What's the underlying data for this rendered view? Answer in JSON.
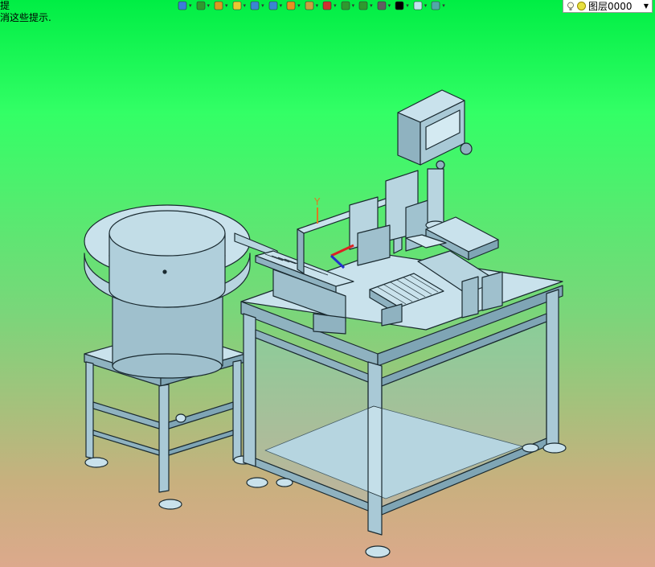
{
  "status": {
    "line1": "提",
    "line2": "消这些提示."
  },
  "toolbar": {
    "tools": [
      {
        "icon": "exit-sketch-icon",
        "color": "#3b7dd8"
      },
      {
        "icon": "smart-dimension-icon",
        "color": "#2e9a2e"
      },
      {
        "icon": "pencil-icon",
        "color": "#d89a20"
      },
      {
        "icon": "feature-yellow-icon",
        "color": "#e8c830"
      },
      {
        "icon": "view-cube-icon",
        "color": "#3a86d4"
      },
      {
        "icon": "section-view-icon",
        "color": "#3a86d4"
      },
      {
        "icon": "display-style-icon",
        "color": "#e89020"
      },
      {
        "icon": "appearance-icon",
        "color": "#c8a040"
      },
      {
        "icon": "triad-icon",
        "color": "#d03030"
      },
      {
        "icon": "view-settings-icon",
        "color": "#2e9a2e"
      },
      {
        "icon": "scene-icon",
        "color": "#2e9a2e"
      },
      {
        "icon": "monitor-icon",
        "color": "#606060"
      },
      {
        "icon": "line-thickness-icon",
        "color": "#000000"
      },
      {
        "icon": "color-swatch-icon",
        "color": "#bfe3ef"
      },
      {
        "icon": "layer-props-icon",
        "color": "#50a8a8"
      }
    ]
  },
  "layer": {
    "name": "图层0000"
  },
  "triad": {
    "axis_y": "Y"
  },
  "colors": {
    "metal": "#a9c9d6",
    "metal_dark": "#7fa5b5",
    "metal_light": "#c9e2ec",
    "edge": "#1a2a30",
    "bg_top": "#00ee44",
    "bg_bottom": "#dca98c"
  }
}
